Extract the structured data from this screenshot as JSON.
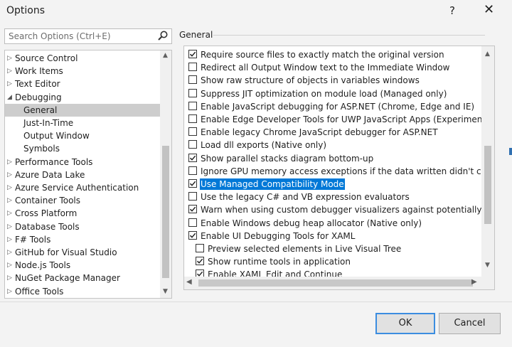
{
  "window": {
    "title": "Options",
    "help_label": "?",
    "close_label": "✕"
  },
  "search": {
    "placeholder": "Search Options (Ctrl+E)"
  },
  "tree": {
    "items": [
      {
        "label": "Source Control",
        "expand": "collapsed",
        "level": 0
      },
      {
        "label": "Work Items",
        "expand": "collapsed",
        "level": 0
      },
      {
        "label": "Text Editor",
        "expand": "collapsed",
        "level": 0
      },
      {
        "label": "Debugging",
        "expand": "expanded",
        "level": 0
      },
      {
        "label": "General",
        "expand": "none",
        "level": 1,
        "selected": true
      },
      {
        "label": "Just-In-Time",
        "expand": "none",
        "level": 1
      },
      {
        "label": "Output Window",
        "expand": "none",
        "level": 1
      },
      {
        "label": "Symbols",
        "expand": "none",
        "level": 1
      },
      {
        "label": "Performance Tools",
        "expand": "collapsed",
        "level": 0
      },
      {
        "label": "Azure Data Lake",
        "expand": "collapsed",
        "level": 0
      },
      {
        "label": "Azure Service Authentication",
        "expand": "collapsed",
        "level": 0
      },
      {
        "label": "Container Tools",
        "expand": "collapsed",
        "level": 0
      },
      {
        "label": "Cross Platform",
        "expand": "collapsed",
        "level": 0
      },
      {
        "label": "Database Tools",
        "expand": "collapsed",
        "level": 0
      },
      {
        "label": "F# Tools",
        "expand": "collapsed",
        "level": 0
      },
      {
        "label": "GitHub for Visual Studio",
        "expand": "collapsed",
        "level": 0
      },
      {
        "label": "Node.js Tools",
        "expand": "collapsed",
        "level": 0
      },
      {
        "label": "NuGet Package Manager",
        "expand": "collapsed",
        "level": 0
      },
      {
        "label": "Office Tools",
        "expand": "collapsed",
        "level": 0
      }
    ]
  },
  "section_label": "General",
  "options": [
    {
      "label": "Require source files to exactly match the original version",
      "checked": true,
      "indent": 0
    },
    {
      "label": "Redirect all Output Window text to the Immediate Window",
      "checked": false,
      "indent": 0
    },
    {
      "label": "Show raw structure of objects in variables windows",
      "checked": false,
      "indent": 0
    },
    {
      "label": "Suppress JIT optimization on module load (Managed only)",
      "checked": false,
      "indent": 0
    },
    {
      "label": "Enable JavaScript debugging for ASP.NET (Chrome, Edge and IE)",
      "checked": false,
      "indent": 0
    },
    {
      "label": "Enable Edge Developer Tools for UWP JavaScript Apps (Experimental)",
      "checked": false,
      "indent": 0
    },
    {
      "label": "Enable legacy Chrome JavaScript debugger for ASP.NET",
      "checked": false,
      "indent": 0
    },
    {
      "label": "Load dll exports (Native only)",
      "checked": false,
      "indent": 0
    },
    {
      "label": "Show parallel stacks diagram bottom-up",
      "checked": true,
      "indent": 0
    },
    {
      "label": "Ignore GPU memory access exceptions if the data written didn't change th",
      "checked": false,
      "indent": 0
    },
    {
      "label": "Use Managed Compatibility Mode",
      "checked": true,
      "indent": 0,
      "highlighted": true
    },
    {
      "label": "Use the legacy C# and VB expression evaluators",
      "checked": false,
      "indent": 0
    },
    {
      "label": "Warn when using custom debugger visualizers against potentially unsafe p",
      "checked": true,
      "indent": 0
    },
    {
      "label": "Enable Windows debug heap allocator (Native only)",
      "checked": false,
      "indent": 0
    },
    {
      "label": "Enable UI Debugging Tools for XAML",
      "checked": true,
      "indent": 0
    },
    {
      "label": "Preview selected elements in Live Visual Tree",
      "checked": false,
      "indent": 1
    },
    {
      "label": "Show runtime tools in application",
      "checked": true,
      "indent": 1
    },
    {
      "label": "Enable XAML Edit and Continue",
      "checked": true,
      "indent": 1
    }
  ],
  "buttons": {
    "ok": "OK",
    "cancel": "Cancel"
  },
  "colors": {
    "selection_blue": "#0078d7",
    "ok_border": "#3c8de0"
  }
}
